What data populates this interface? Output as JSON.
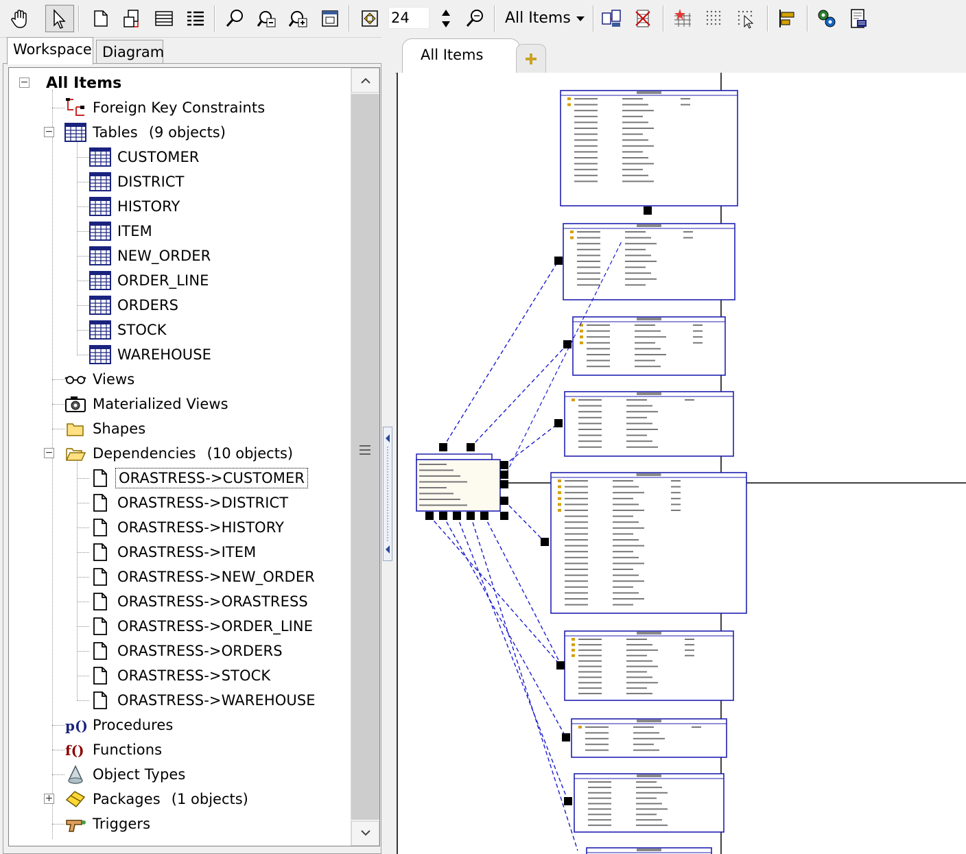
{
  "toolbar": {
    "zoom_value": "24",
    "filter_value": "All Items"
  },
  "left_tabs": [
    {
      "label": "Workspace",
      "active": true
    },
    {
      "label": "Diagram",
      "active": false
    }
  ],
  "tree": {
    "root": "All Items",
    "foreign_keys": "Foreign Key Constraints",
    "tables": {
      "label": "Tables",
      "count": "(9 objects)"
    },
    "table_items": [
      "CUSTOMER",
      "DISTRICT",
      "HISTORY",
      "ITEM",
      "NEW_ORDER",
      "ORDER_LINE",
      "ORDERS",
      "STOCK",
      "WAREHOUSE"
    ],
    "views": "Views",
    "materialized_views": "Materialized Views",
    "shapes": "Shapes",
    "dependencies": {
      "label": "Dependencies",
      "count": "(10 objects)"
    },
    "dependency_items": [
      "ORASTRESS->CUSTOMER",
      "ORASTRESS->DISTRICT",
      "ORASTRESS->HISTORY",
      "ORASTRESS->ITEM",
      "ORASTRESS->NEW_ORDER",
      "ORASTRESS->ORASTRESS",
      "ORASTRESS->ORDER_LINE",
      "ORASTRESS->ORDERS",
      "ORASTRESS->STOCK",
      "ORASTRESS->WAREHOUSE"
    ],
    "procedures": "Procedures",
    "functions": "Functions",
    "object_types": "Object Types",
    "packages": {
      "label": "Packages",
      "count": "(1 objects)"
    },
    "triggers": "Triggers"
  },
  "diagram": {
    "tab_label": "All Items"
  },
  "colors": {
    "entity_border": "#1f1fb0",
    "relationship_line": "#1a1ad0",
    "table_icon": "#1a237e",
    "key_icon": "#d4a000"
  }
}
